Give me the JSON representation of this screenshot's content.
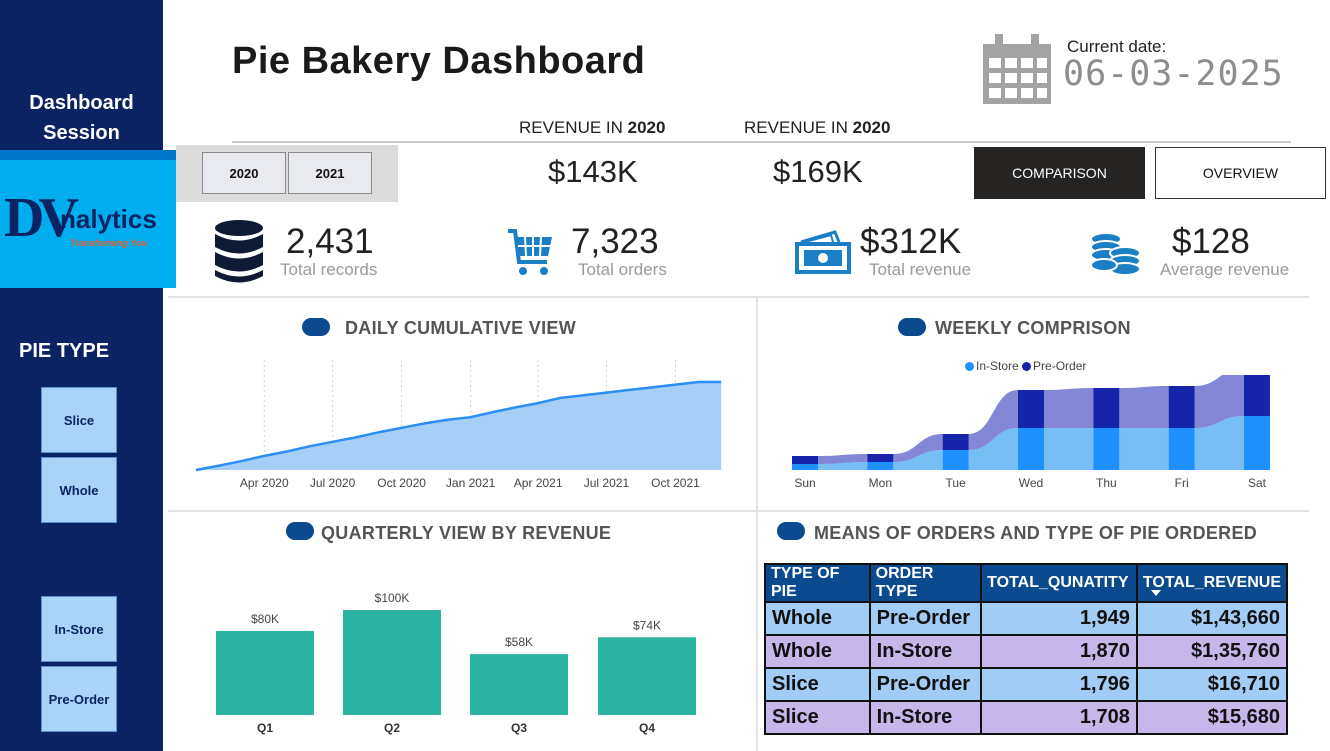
{
  "sidebar": {
    "title": "Dashboard Session",
    "logo": {
      "letters": "DV",
      "word": "nalytics",
      "tagline": "Transforming You"
    },
    "pie_type_label": "PIE TYPE",
    "buttons": [
      {
        "label": "Slice"
      },
      {
        "label": "Whole"
      },
      {
        "label": "In-Store"
      },
      {
        "label": "Pre-Order"
      }
    ]
  },
  "header": {
    "title": "Pie Bakery Dashboard",
    "current_date_label": "Current date:",
    "current_date": "06-03-2025"
  },
  "revenue": [
    {
      "label_prefix": "REVENUE IN ",
      "year": "2020",
      "value": "$143K"
    },
    {
      "label_prefix": "REVENUE IN ",
      "year": "2020",
      "value": "$169K"
    }
  ],
  "year_filter": [
    {
      "label": "2020"
    },
    {
      "label": "2021"
    }
  ],
  "view_buttons": {
    "comparison": "COMPARISON",
    "overview": "OVERVIEW"
  },
  "kpis": [
    {
      "value": "2,431",
      "label": "Total records",
      "icon": "database-icon"
    },
    {
      "value": "7,323",
      "label": "Total orders",
      "icon": "shopping-cart-icon"
    },
    {
      "value": "$312K",
      "label": "Total revenue",
      "icon": "cash-icon"
    },
    {
      "value": "$128",
      "label": "Average revenue",
      "icon": "coins-icon"
    }
  ],
  "colors": {
    "sidebar": "#0a2463",
    "accent": "#0b4a8f",
    "area_line": "#2b8ef0",
    "area_fill": "#a6cff8",
    "bar": "#2bb39f",
    "in_store": "#1e90ff",
    "pre_order": "#1524a8",
    "row_a": "#a0ccf5",
    "row_b": "#c7b6ea"
  },
  "chart_data": [
    {
      "type": "area",
      "title": "DAILY CUMULATIVE VIEW",
      "x_ticks": [
        "Apr 2020",
        "Jul 2020",
        "Oct 2020",
        "Jan 2021",
        "Apr 2021",
        "Jul 2021",
        "Oct 2021"
      ],
      "x": [
        "2020-01-01",
        "2020-02-01",
        "2020-03-01",
        "2020-04-01",
        "2020-05-01",
        "2020-06-01",
        "2020-07-01",
        "2020-08-01",
        "2020-09-01",
        "2020-10-01",
        "2020-11-01",
        "2020-12-01",
        "2021-01-01",
        "2021-02-01",
        "2021-03-01",
        "2021-04-01",
        "2021-05-01",
        "2021-06-01",
        "2021-07-01",
        "2021-08-01",
        "2021-09-01",
        "2021-10-01",
        "2021-11-01",
        "2021-12-01"
      ],
      "values": [
        0,
        5,
        10,
        16,
        21,
        27,
        32,
        37,
        43,
        48,
        53,
        57,
        60,
        66,
        71,
        76,
        82,
        85,
        88,
        91,
        94,
        97,
        100,
        100
      ],
      "ylabel": "",
      "grid": "vertical dotted"
    },
    {
      "type": "area",
      "subtype": "ribbon",
      "title": "WEEKLY COMPRISON",
      "categories": [
        "Sun",
        "Mon",
        "Tue",
        "Wed",
        "Thu",
        "Fri",
        "Sat"
      ],
      "series": [
        {
          "name": "In-Store",
          "values": [
            3,
            4,
            10,
            21,
            21,
            21,
            27
          ]
        },
        {
          "name": "Pre-Order",
          "values": [
            4,
            4,
            8,
            19,
            20,
            21,
            24
          ]
        }
      ],
      "legend": "top"
    },
    {
      "type": "bar",
      "title": "QUARTERLY VIEW BY REVENUE",
      "categories": [
        "Q1",
        "Q2",
        "Q3",
        "Q4"
      ],
      "values": [
        80,
        100,
        58,
        74
      ],
      "data_labels": [
        "$80K",
        "$100K",
        "$58K",
        "$74K"
      ],
      "ylim": [
        0,
        100
      ]
    },
    {
      "type": "table",
      "title": "MEANS OF ORDERS AND TYPE OF PIE ORDERED",
      "columns": [
        "TYPE OF PIE",
        "ORDER TYPE",
        "TOTAL_QUNATITY",
        "TOTAL_REVENUE"
      ],
      "rows": [
        [
          "Whole",
          "Pre-Order",
          "1,949",
          "$1,43,660"
        ],
        [
          "Whole",
          "In-Store",
          "1,870",
          "$1,35,760"
        ],
        [
          "Slice",
          "Pre-Order",
          "1,796",
          "$16,710"
        ],
        [
          "Slice",
          "In-Store",
          "1,708",
          "$15,680"
        ]
      ],
      "sorted_by": "TOTAL_REVENUE"
    }
  ]
}
